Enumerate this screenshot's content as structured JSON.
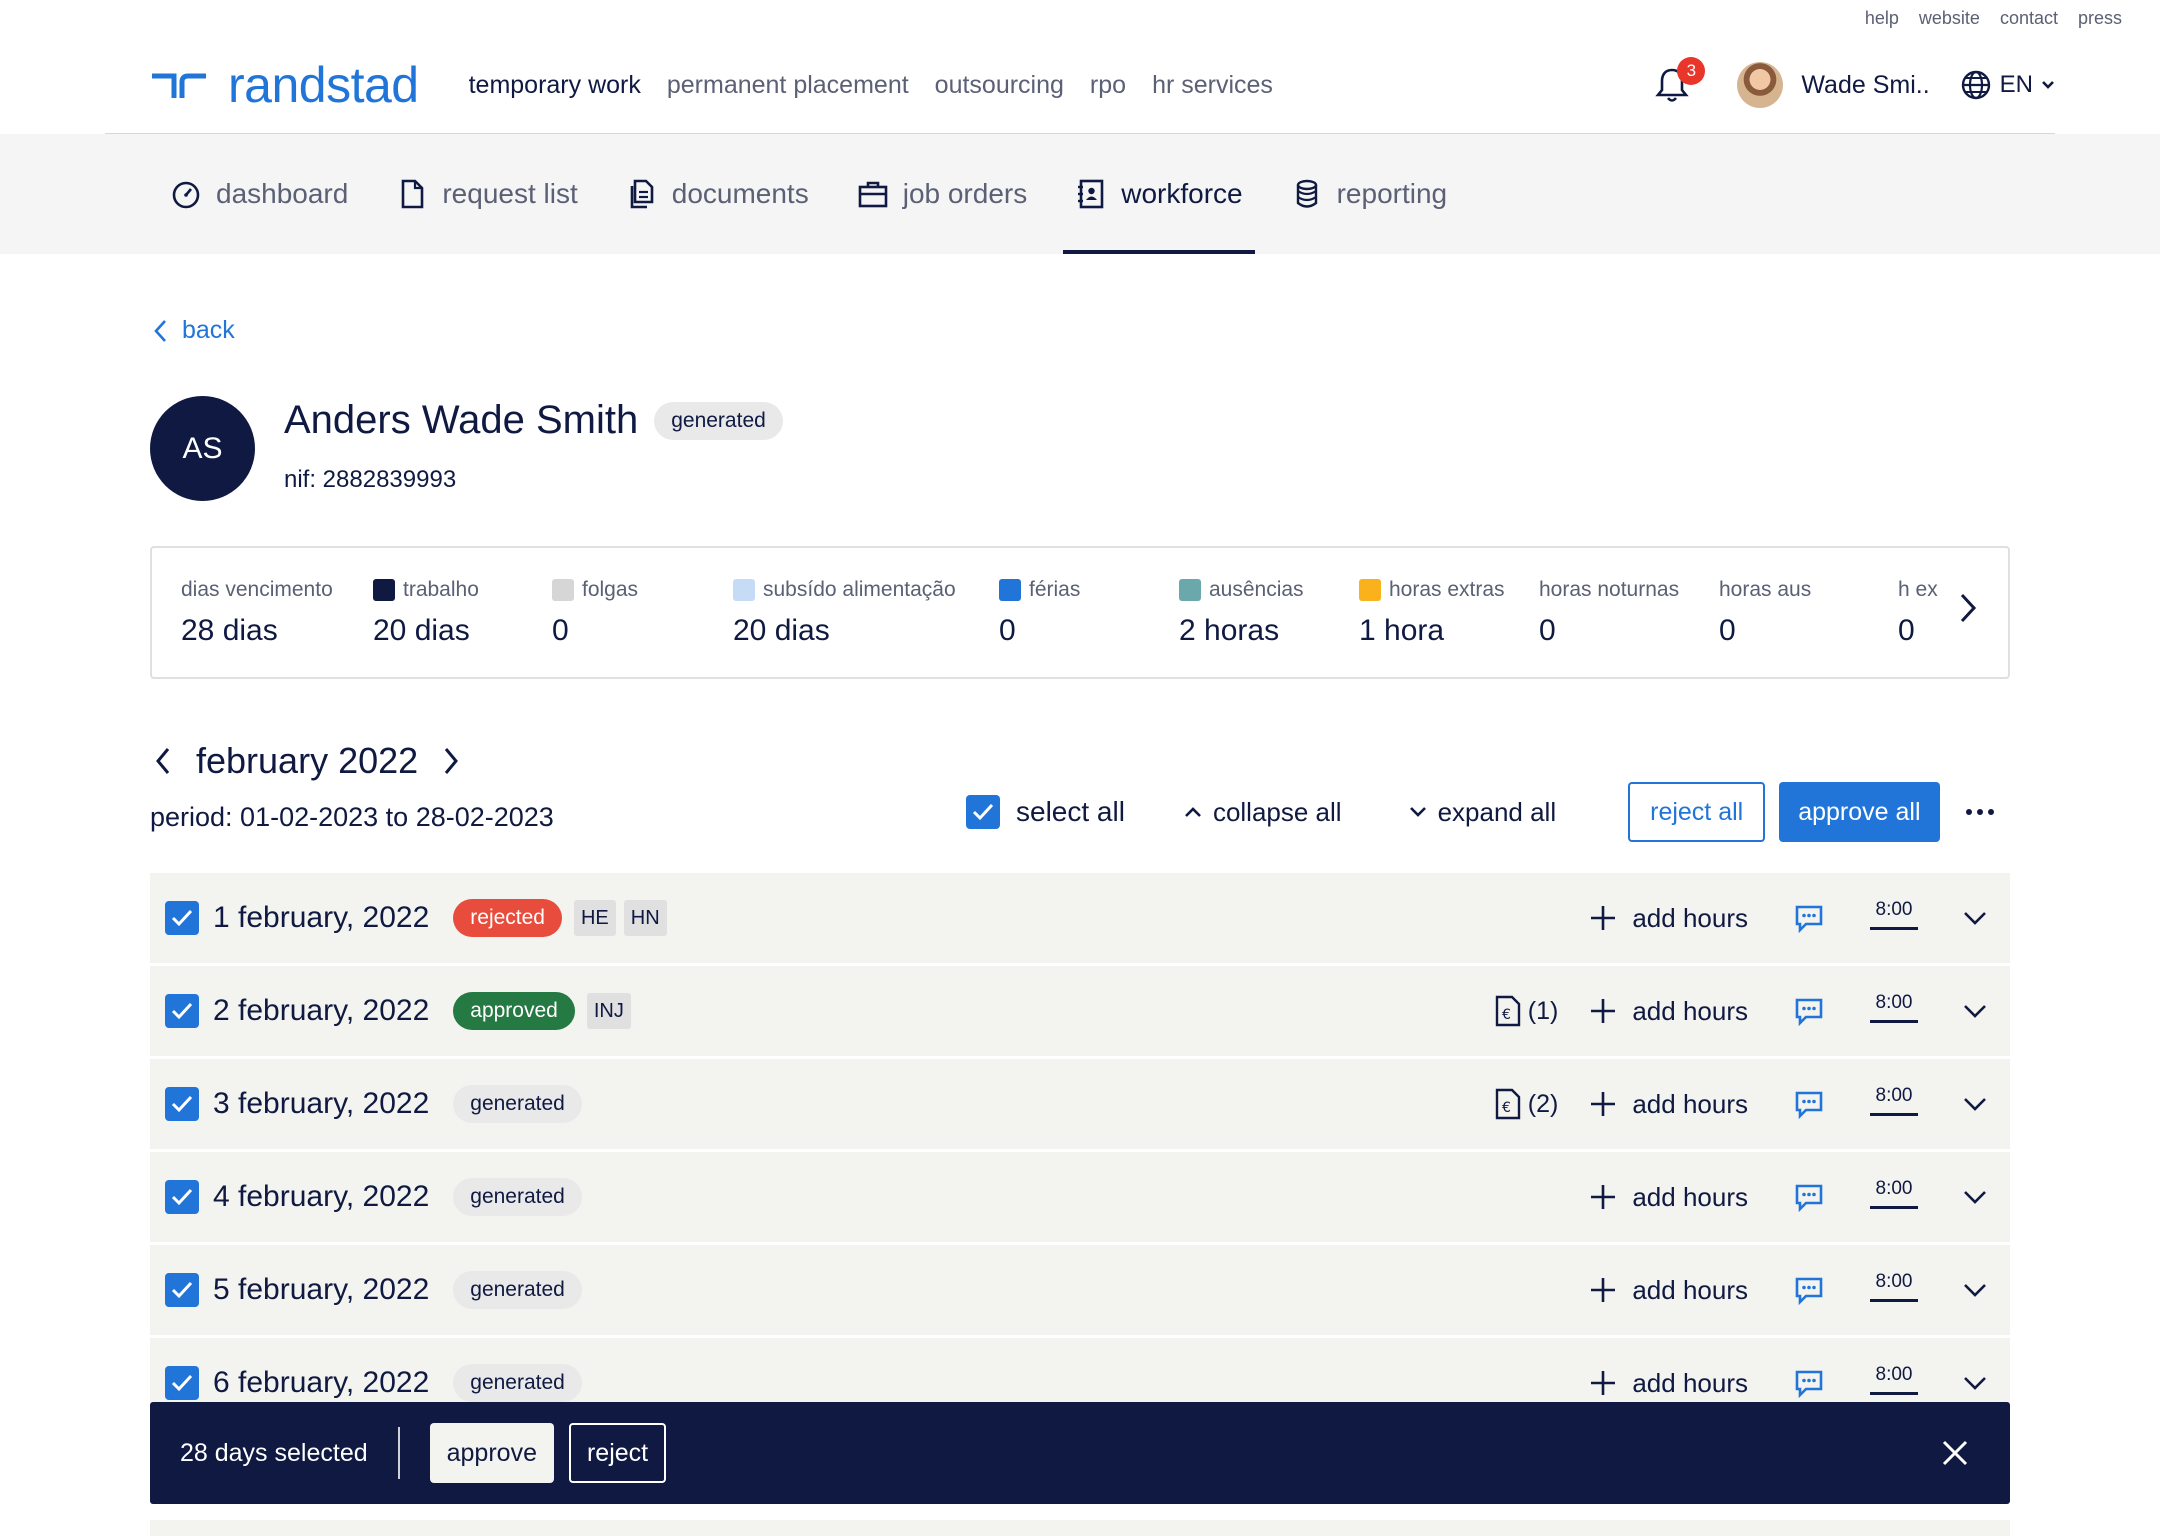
{
  "util_links": [
    "help",
    "website",
    "contact",
    "press"
  ],
  "brand": {
    "name": "randstad",
    "color": "#2175d9"
  },
  "main_nav": [
    "temporary work",
    "permanent placement",
    "outsourcing",
    "rpo",
    "hr services"
  ],
  "notifications": {
    "count": "3"
  },
  "user": {
    "name": "Wade Smi.."
  },
  "language": "EN",
  "sub_nav": [
    {
      "label": "dashboard",
      "icon": "gauge-icon"
    },
    {
      "label": "request list",
      "icon": "document-icon"
    },
    {
      "label": "documents",
      "icon": "documents-icon"
    },
    {
      "label": "job orders",
      "icon": "briefcase-icon"
    },
    {
      "label": "workforce",
      "icon": "contact-book-icon",
      "active": true
    },
    {
      "label": "reporting",
      "icon": "database-icon"
    }
  ],
  "back_label": "back",
  "profile": {
    "initials": "AS",
    "name": "Anders Wade Smith",
    "status": "generated",
    "nif": "nif: 2882839993"
  },
  "summary": [
    {
      "label": "dias vencimento",
      "value": "28 dias",
      "color": null
    },
    {
      "label": "trabalho",
      "value": "20 dias",
      "color": "#0f1941"
    },
    {
      "label": "folgas",
      "value": "0",
      "color": "#d6d6d6"
    },
    {
      "label": "subsído alimentação",
      "value": "20 dias",
      "color": "#c6dbf5"
    },
    {
      "label": "férias",
      "value": "0",
      "color": "#2175d9"
    },
    {
      "label": "ausências",
      "value": "2 horas",
      "color": "#6aa8ac"
    },
    {
      "label": "horas extras",
      "value": "1 hora",
      "color": "#f9b21b"
    },
    {
      "label": "horas noturnas",
      "value": "0",
      "color": null
    },
    {
      "label": "horas aus",
      "value": "0",
      "color": null
    },
    {
      "label": "h ex",
      "value": "0",
      "color": null
    }
  ],
  "month": "february 2022",
  "period": "period: 01-02-2023 to 28-02-2023",
  "toolbar": {
    "select_all": "select all",
    "collapse_all": "collapse all",
    "expand_all": "expand all",
    "reject_all": "reject all",
    "approve_all": "approve all"
  },
  "days": [
    {
      "date": "1 february, 2022",
      "status": "rejected",
      "tags": [
        "HE",
        "HN"
      ],
      "expenses": null,
      "add_label": "add hours",
      "hours": "8:00"
    },
    {
      "date": "2 february, 2022",
      "status": "approved",
      "tags": [
        "INJ"
      ],
      "expenses": "(1)",
      "add_label": "add hours",
      "hours": "8:00"
    },
    {
      "date": "3 february, 2022",
      "status": "generated",
      "tags": [],
      "expenses": "(2)",
      "add_label": "add hours",
      "hours": "8:00"
    },
    {
      "date": "4 february, 2022",
      "status": "generated",
      "tags": [],
      "expenses": null,
      "add_label": "add hours",
      "hours": "8:00"
    },
    {
      "date": "5 february, 2022",
      "status": "generated",
      "tags": [],
      "expenses": null,
      "add_label": "add hours",
      "hours": "8:00"
    },
    {
      "date": "6 february, 2022",
      "status": "generated",
      "tags": [],
      "expenses": null,
      "add_label": "add hours",
      "hours": "8:00"
    }
  ],
  "selection_bar": {
    "count_label": "28 days selected",
    "approve": "approve",
    "reject": "reject"
  }
}
